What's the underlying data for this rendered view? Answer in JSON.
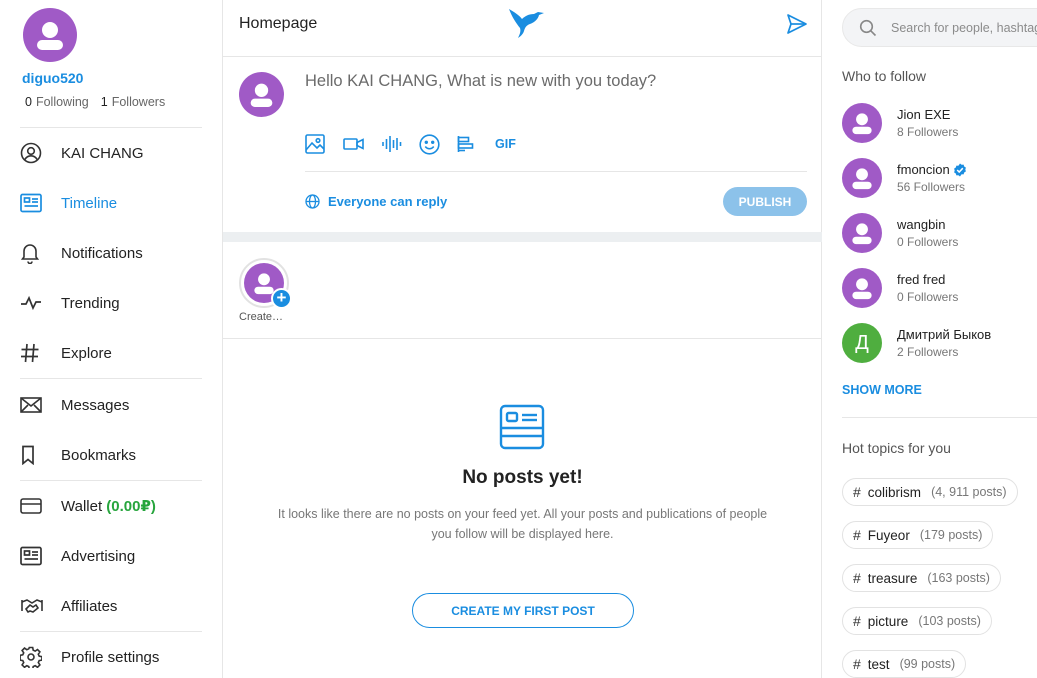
{
  "profile": {
    "username": "diguo520",
    "following_count": "0",
    "following_label": "Following",
    "followers_count": "1",
    "followers_label": "Followers"
  },
  "nav": {
    "items": [
      {
        "label": "KAI CHANG",
        "icon": "user-circle-icon"
      },
      {
        "label": "Timeline",
        "icon": "timeline-icon",
        "active": true
      },
      {
        "label": "Notifications",
        "icon": "bell-icon"
      },
      {
        "label": "Trending",
        "icon": "pulse-icon"
      },
      {
        "label": "Explore",
        "icon": "hashtag-icon"
      },
      {
        "label": "Messages",
        "icon": "envelope-icon"
      },
      {
        "label": "Bookmarks",
        "icon": "bookmark-icon"
      },
      {
        "label": "Wallet",
        "icon": "wallet-icon"
      },
      {
        "label": "Advertising",
        "icon": "ad-icon"
      },
      {
        "label": "Affiliates",
        "icon": "handshake-icon"
      },
      {
        "label": "Profile settings",
        "icon": "gear-icon"
      }
    ],
    "wallet_amount": "(0.00₽)"
  },
  "header": {
    "title": "Homepage",
    "logo_icon": "bird-logo-icon",
    "send_icon": "send-icon"
  },
  "composer": {
    "placeholder": "Hello KAI CHANG, What is new with you today?",
    "gif_label": "GIF",
    "reply_label": "Everyone can reply",
    "publish_label": "PUBLISH"
  },
  "stories": {
    "create_label": "Create…"
  },
  "empty": {
    "title": "No posts yet!",
    "description": "It looks like there are no posts on your feed yet. All your posts and publications of people you follow will be displayed here.",
    "button_label": "CREATE MY FIRST POST"
  },
  "search": {
    "placeholder": "Search for people, hashtags"
  },
  "who_to_follow": {
    "title": "Who to follow",
    "users": [
      {
        "name": "Jion EXE",
        "followers": "8 Followers"
      },
      {
        "name": "fmoncion",
        "followers": "56 Followers",
        "verified": true
      },
      {
        "name": "wangbin",
        "followers": "0 Followers"
      },
      {
        "name": "fred fred",
        "followers": "0 Followers"
      },
      {
        "name": "Дмитрий Быков",
        "followers": "2 Followers",
        "initial": "Д"
      }
    ],
    "show_more_label": "SHOW MORE"
  },
  "hot_topics": {
    "title": "Hot topics for you",
    "topics": [
      {
        "hash": "#",
        "name": "colibrism",
        "count": "(4, 911 posts)"
      },
      {
        "hash": "#",
        "name": "Fuyeor",
        "count": "(179 posts)"
      },
      {
        "hash": "#",
        "name": "treasure",
        "count": "(163 posts)"
      },
      {
        "hash": "#",
        "name": "picture",
        "count": "(103 posts)"
      },
      {
        "hash": "#",
        "name": "test",
        "count": "(99 posts)"
      }
    ]
  },
  "colors": {
    "accent": "#1a8de0",
    "avatar": "#a05ac6",
    "wallet_green": "#27a53d",
    "publish_disabled": "#8cc2ea"
  }
}
